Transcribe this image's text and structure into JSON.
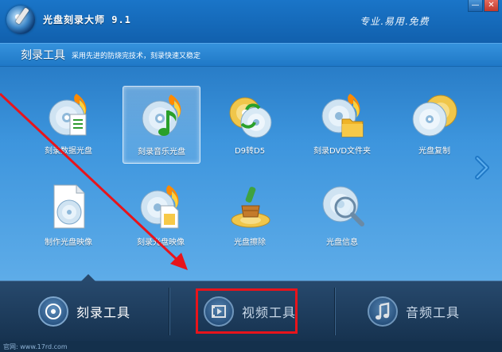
{
  "window": {
    "title": "光盘刻录大师 9.1",
    "slogan": "专业.易用.免费",
    "controls": {
      "minimize": "—",
      "close": "✕"
    }
  },
  "section": {
    "title": "刻录工具",
    "description": "采用先进的防烧完技术，刻录快速又稳定"
  },
  "tools": [
    {
      "label": "刻录数据光盘",
      "icon": "burn-data-disc-icon"
    },
    {
      "label": "刻录音乐光盘",
      "icon": "burn-music-disc-icon",
      "selected": true
    },
    {
      "label": "D9转D5",
      "icon": "d9-to-d5-icon"
    },
    {
      "label": "刻录DVD文件夹",
      "icon": "burn-dvd-folder-icon"
    },
    {
      "label": "光盘复制",
      "icon": "disc-copy-icon"
    },
    {
      "label": "制作光盘映像",
      "icon": "make-disc-image-icon"
    },
    {
      "label": "刻录光盘映像",
      "icon": "burn-disc-image-icon"
    },
    {
      "label": "光盘擦除",
      "icon": "disc-erase-icon"
    },
    {
      "label": "光盘信息",
      "icon": "disc-info-icon"
    }
  ],
  "tabs": [
    {
      "label": "刻录工具",
      "icon": "burn-disc-tab-icon",
      "active": true
    },
    {
      "label": "视频工具",
      "icon": "film-tab-icon",
      "active": false
    },
    {
      "label": "音频工具",
      "icon": "music-note-tab-icon",
      "active": false
    }
  ],
  "status": {
    "text": "官网: www.17rd.com"
  },
  "colors": {
    "accent": "#1a75c8",
    "highlight_box": "#e8141b",
    "annotation_arrow": "#e8141b"
  }
}
